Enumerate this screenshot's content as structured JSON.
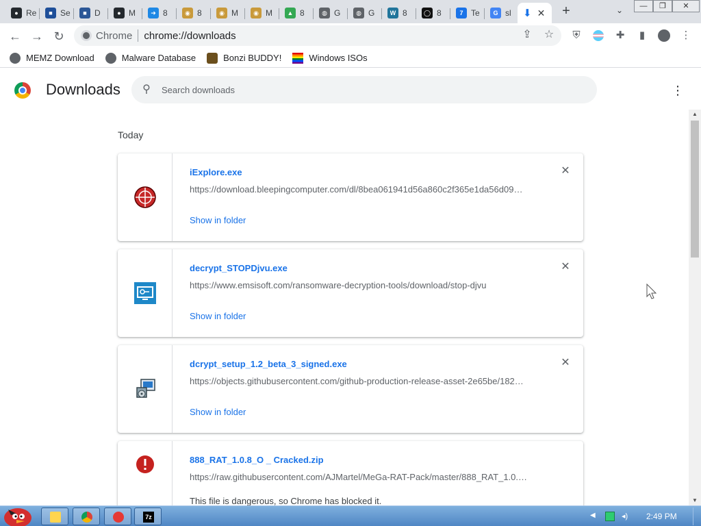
{
  "tabs": [
    {
      "label": "Re",
      "fav": "github-icon",
      "color": "#24292e",
      "glyph": "●"
    },
    {
      "label": "Se",
      "fav": "app-icon",
      "color": "#1f4f99",
      "glyph": "■"
    },
    {
      "label": "D",
      "fav": "app-icon",
      "color": "#2b5797",
      "glyph": "■"
    },
    {
      "label": "M",
      "fav": "github-icon",
      "color": "#24292e",
      "glyph": "●"
    },
    {
      "label": "8",
      "fav": "arrow-icon",
      "color": "#1e88e5",
      "glyph": "➜"
    },
    {
      "label": "8",
      "fav": "badge-icon",
      "color": "#c99a3b",
      "glyph": "◉"
    },
    {
      "label": "M",
      "fav": "badge-icon",
      "color": "#c99a3b",
      "glyph": "◉"
    },
    {
      "label": "M",
      "fav": "badge-icon",
      "color": "#c99a3b",
      "glyph": "◉"
    },
    {
      "label": "8",
      "fav": "drive-icon",
      "color": "#34a853",
      "glyph": "▲"
    },
    {
      "label": "G",
      "fav": "globe-icon",
      "color": "#5f6368",
      "glyph": "◍"
    },
    {
      "label": "G",
      "fav": "globe-icon",
      "color": "#5f6368",
      "glyph": "◍"
    },
    {
      "label": "8",
      "fav": "wordpress-icon",
      "color": "#21759b",
      "glyph": "W"
    },
    {
      "label": "8",
      "fav": "square-icon",
      "color": "#111111",
      "glyph": "◯"
    },
    {
      "label": "Te",
      "fav": "7zip-icon",
      "color": "#1a73e8",
      "glyph": "7"
    },
    {
      "label": "sl",
      "fav": "google-icon",
      "color": "#4285f4",
      "glyph": "G"
    }
  ],
  "active_tab": {
    "icon": "download-icon"
  },
  "toolbar": {
    "site_label": "Chrome",
    "url": "chrome://downloads"
  },
  "bookmarks": [
    {
      "label": "MEMZ Download",
      "icon": "globe-icon"
    },
    {
      "label": "Malware Database",
      "icon": "globe-icon"
    },
    {
      "label": "Bonzi BUDDY!",
      "icon": "bonzi-icon"
    },
    {
      "label": "Windows ISOs",
      "icon": "rainbow-flag-icon"
    }
  ],
  "downloads": {
    "title": "Downloads",
    "search_placeholder": "Search downloads",
    "section_label": "Today",
    "items": [
      {
        "name": "iExplore.exe",
        "url": "https://download.bleepingcomputer.com/dl/8bea061941d56a860c2f365e1da56d09…",
        "action": "Show in folder",
        "icon": "crosshair-icon"
      },
      {
        "name": "decrypt_STOPDjvu.exe",
        "url": "https://www.emsisoft.com/ransomware-decryption-tools/download/stop-djvu",
        "action": "Show in folder",
        "icon": "key-monitor-icon"
      },
      {
        "name": "dcrypt_setup_1.2_beta_3_signed.exe",
        "url": "https://objects.githubusercontent.com/github-production-release-asset-2e65be/182…",
        "action": "Show in folder",
        "icon": "installer-icon"
      },
      {
        "name": "888_RAT_1.0.8_O _ Cracked.zip",
        "url": "https://raw.githubusercontent.com/AJMartel/MeGa-RAT-Pack/master/888_RAT_1.0.…",
        "warning": "This file is dangerous, so Chrome has blocked it.",
        "icon": "danger-icon"
      }
    ]
  },
  "taskbar": {
    "clock": "2:49 PM"
  }
}
